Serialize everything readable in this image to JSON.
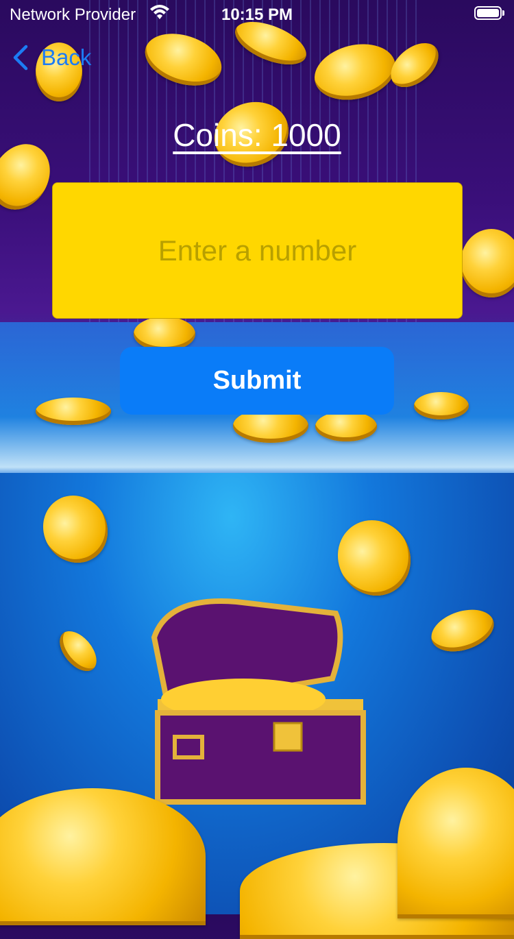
{
  "status_bar": {
    "carrier": "Network Provider",
    "time": "10:15 PM",
    "wifi_icon": "wifi-icon",
    "battery_icon": "battery-icon"
  },
  "nav": {
    "back_label": "Back",
    "back_icon": "chevron-left-icon"
  },
  "main": {
    "coins_label": "Coins: 1000",
    "input_value": "",
    "input_placeholder": "Enter a number",
    "submit_label": "Submit"
  },
  "colors": {
    "accent": "#0a7cf8",
    "input_background": "#ffd700",
    "back_tint": "#1c7cf4"
  },
  "background": {
    "scene": "treasure-chest-coins-background"
  }
}
